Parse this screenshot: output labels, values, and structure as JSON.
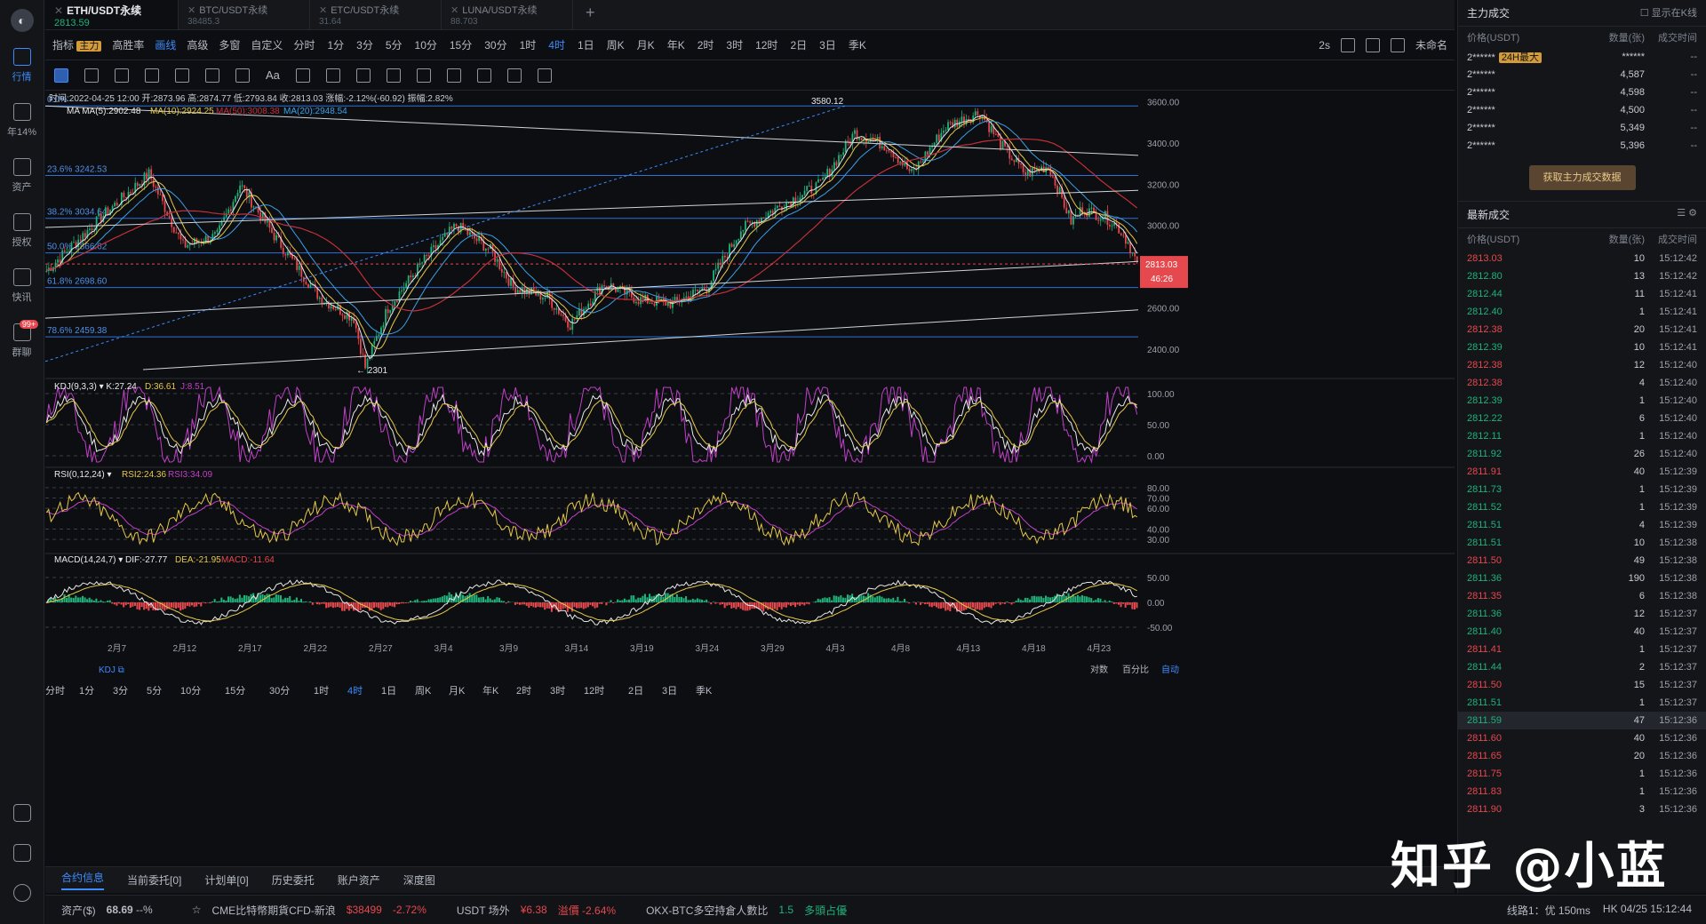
{
  "nav": {
    "items": [
      {
        "label": "行情",
        "active": true
      },
      {
        "label": "年14%",
        "active": false
      },
      {
        "label": "资产",
        "active": false
      },
      {
        "label": "授权",
        "active": false
      },
      {
        "label": "快讯",
        "active": false
      },
      {
        "label": "群聊",
        "active": false,
        "badge": "99+"
      }
    ]
  },
  "tabs": [
    {
      "name": "ETH/USDT永续",
      "price": "2813.59",
      "active": true
    },
    {
      "name": "BTC/USDT永续",
      "price": "38485.3",
      "active": false
    },
    {
      "name": "ETC/USDT永续",
      "price": "31.64",
      "active": false
    },
    {
      "name": "LUNA/USDT永续",
      "price": "88.703",
      "active": false
    }
  ],
  "toolbar": {
    "indicator": "指标",
    "main_tag": "主力",
    "winrate": "高胜率",
    "draw": "画线",
    "advanced": "高级",
    "multi": "多窗",
    "custom": "自定义",
    "intervals": [
      "分时",
      "1分",
      "3分",
      "5分",
      "10分",
      "15分",
      "30分",
      "1时",
      "4时",
      "1日",
      "周K",
      "月K",
      "年K",
      "2时",
      "3时",
      "12时",
      "2日",
      "3日",
      "季K"
    ],
    "active_interval": "4时",
    "refresh": "2s",
    "layout_name": "未命名"
  },
  "ohlc": {
    "time": "时间:2022-04-25 12:00",
    "open_label": "开:",
    "open": "2873.96",
    "high_label": "高:",
    "high": "2874.77",
    "low_label": "低:",
    "low": "2793.84",
    "close_label": "收:",
    "close": "2813.03",
    "change_label": "涨幅:",
    "change": "-2.12%(-60.92)",
    "amp_label": "振幅:",
    "amp": "2.82%"
  },
  "ma": {
    "label": "MA",
    "ma5": "MA(5):2902.48",
    "ma10": "MA(10):2924.25",
    "ma50": "MA(50):3008.38",
    "ma20": "MA(20):2948.54"
  },
  "fib": [
    {
      "label": "0.0%",
      "price": 3580.12
    },
    {
      "label": "23.6% 3242.53",
      "price": 3242.53
    },
    {
      "label": "38.2% 3034.64",
      "price": 3034.64
    },
    {
      "label": "50.0% 2866.62",
      "price": 2866.62
    },
    {
      "label": "61.8% 2698.60",
      "price": 2698.6
    },
    {
      "label": "78.6% 2459.38",
      "price": 2459.38
    }
  ],
  "price_axis": [
    "3600.00",
    "3400.00",
    "3200.00",
    "3000.00",
    "2800.00",
    "2600.00",
    "2400.00"
  ],
  "annotations": {
    "high": "3580.12",
    "low": "2301"
  },
  "current": {
    "price": "2813.03",
    "countdown": "46:26"
  },
  "kdj": {
    "label": "KDJ(9,3,3)",
    "k": "K:27.24",
    "d": "D:36.61",
    "j": "J:8.51",
    "axis": [
      "100.00",
      "50.00",
      "0.00"
    ]
  },
  "rsi": {
    "label": "RSI(0,12,24)",
    "r2": "RSI2:24.36",
    "r3": "RSI3:34.09",
    "axis": [
      "80.00",
      "70.00",
      "60.00",
      "40.00",
      "30.00"
    ]
  },
  "macd": {
    "label": "MACD(14,24,7)",
    "dif": "DIF:-27.77",
    "dea": "DEA:-21.95",
    "macd": "MACD:-11.64",
    "axis": [
      "50.00",
      "0.00",
      "-50.00"
    ]
  },
  "dates": [
    "2月7",
    "2月12",
    "2月17",
    "2月22",
    "2月27",
    "3月4",
    "3月9",
    "3月14",
    "3月19",
    "3月24",
    "3月29",
    "4月3",
    "4月8",
    "4月13",
    "4月18",
    "4月23"
  ],
  "chart_footer": {
    "kdj": "KDJ",
    "log": "对数",
    "percent": "百分比",
    "auto": "自动"
  },
  "intervals_bottom": [
    "分时",
    "1分",
    "3分",
    "5分",
    "10分",
    "15分",
    "30分",
    "1时",
    "4时",
    "1日",
    "周K",
    "月K",
    "年K",
    "2时",
    "3时",
    "12时",
    "2日",
    "3日",
    "季K"
  ],
  "bottom_tabs": [
    "合约信息",
    "当前委托[0]",
    "计划单[0]",
    "历史委托",
    "账户资产",
    "深度图"
  ],
  "status": {
    "assets_label": "资产($)",
    "assets": "68.69",
    "assets_suffix": "--%",
    "cme": "CME比特幣期貨CFD-新浪",
    "cme_price": "$38499",
    "cme_chg": "-2.72%",
    "usdt_label": "USDT 场外",
    "usdt_price": "¥6.38",
    "premium": "溢價 -2.64%",
    "okx": "OKX-BTC多空持倉人數比",
    "okx_val": "1.5",
    "okx_note": "多頭占優",
    "line": "线路1：优 150ms",
    "clock": "HK 04/25 15:12:44"
  },
  "right": {
    "title": "主力成交",
    "show_k": "显示在K线",
    "cols": [
      "价格(USDT)",
      "数量(张)",
      "成交时间"
    ],
    "main_rows": [
      {
        "p": "2******",
        "tag": "24H最大",
        "q": "******",
        "t": "--"
      },
      {
        "p": "2******",
        "q": "4,587",
        "t": "--"
      },
      {
        "p": "2******",
        "q": "4,598",
        "t": "--"
      },
      {
        "p": "2******",
        "q": "4,500",
        "t": "--"
      },
      {
        "p": "2******",
        "q": "5,349",
        "t": "--"
      },
      {
        "p": "2******",
        "q": "5,396",
        "t": "--"
      }
    ],
    "get_btn": "获取主力成交数据",
    "latest_title": "最新成交",
    "trades": [
      {
        "p": "2813.03",
        "q": "10",
        "t": "15:12:42",
        "s": "sell"
      },
      {
        "p": "2812.80",
        "q": "13",
        "t": "15:12:42",
        "s": "buy"
      },
      {
        "p": "2812.44",
        "q": "11",
        "t": "15:12:41",
        "s": "buy"
      },
      {
        "p": "2812.40",
        "q": "1",
        "t": "15:12:41",
        "s": "buy"
      },
      {
        "p": "2812.38",
        "q": "20",
        "t": "15:12:41",
        "s": "sell"
      },
      {
        "p": "2812.39",
        "q": "10",
        "t": "15:12:41",
        "s": "buy"
      },
      {
        "p": "2812.38",
        "q": "12",
        "t": "15:12:40",
        "s": "sell"
      },
      {
        "p": "2812.38",
        "q": "4",
        "t": "15:12:40",
        "s": "sell"
      },
      {
        "p": "2812.39",
        "q": "1",
        "t": "15:12:40",
        "s": "buy"
      },
      {
        "p": "2812.22",
        "q": "6",
        "t": "15:12:40",
        "s": "buy"
      },
      {
        "p": "2812.11",
        "q": "1",
        "t": "15:12:40",
        "s": "buy"
      },
      {
        "p": "2811.92",
        "q": "26",
        "t": "15:12:40",
        "s": "buy"
      },
      {
        "p": "2811.91",
        "q": "40",
        "t": "15:12:39",
        "s": "sell"
      },
      {
        "p": "2811.73",
        "q": "1",
        "t": "15:12:39",
        "s": "buy"
      },
      {
        "p": "2811.52",
        "q": "1",
        "t": "15:12:39",
        "s": "buy"
      },
      {
        "p": "2811.51",
        "q": "4",
        "t": "15:12:39",
        "s": "buy"
      },
      {
        "p": "2811.51",
        "q": "10",
        "t": "15:12:38",
        "s": "buy"
      },
      {
        "p": "2811.50",
        "q": "49",
        "t": "15:12:38",
        "s": "sell"
      },
      {
        "p": "2811.36",
        "q": "190",
        "t": "15:12:38",
        "s": "buy"
      },
      {
        "p": "2811.35",
        "q": "6",
        "t": "15:12:38",
        "s": "sell"
      },
      {
        "p": "2811.36",
        "q": "12",
        "t": "15:12:37",
        "s": "buy"
      },
      {
        "p": "2811.40",
        "q": "40",
        "t": "15:12:37",
        "s": "buy"
      },
      {
        "p": "2811.41",
        "q": "1",
        "t": "15:12:37",
        "s": "sell"
      },
      {
        "p": "2811.44",
        "q": "2",
        "t": "15:12:37",
        "s": "buy"
      },
      {
        "p": "2811.50",
        "q": "15",
        "t": "15:12:37",
        "s": "sell"
      },
      {
        "p": "2811.51",
        "q": "1",
        "t": "15:12:37",
        "s": "buy"
      },
      {
        "p": "2811.59",
        "q": "47",
        "t": "15:12:36",
        "s": "buy"
      },
      {
        "p": "2811.60",
        "q": "40",
        "t": "15:12:36",
        "s": "sell"
      },
      {
        "p": "2811.65",
        "q": "20",
        "t": "15:12:36",
        "s": "sell"
      },
      {
        "p": "2811.75",
        "q": "1",
        "t": "15:12:36",
        "s": "sell"
      },
      {
        "p": "2811.83",
        "q": "1",
        "t": "15:12:36",
        "s": "sell"
      },
      {
        "p": "2811.90",
        "q": "3",
        "t": "15:12:36",
        "s": "sell"
      }
    ]
  },
  "watermark": "知乎 @小蓝",
  "colors": {
    "up": "#1fb27a",
    "down": "#e5484d",
    "accent": "#3d8bfd",
    "fib": "#2f6fd8"
  }
}
